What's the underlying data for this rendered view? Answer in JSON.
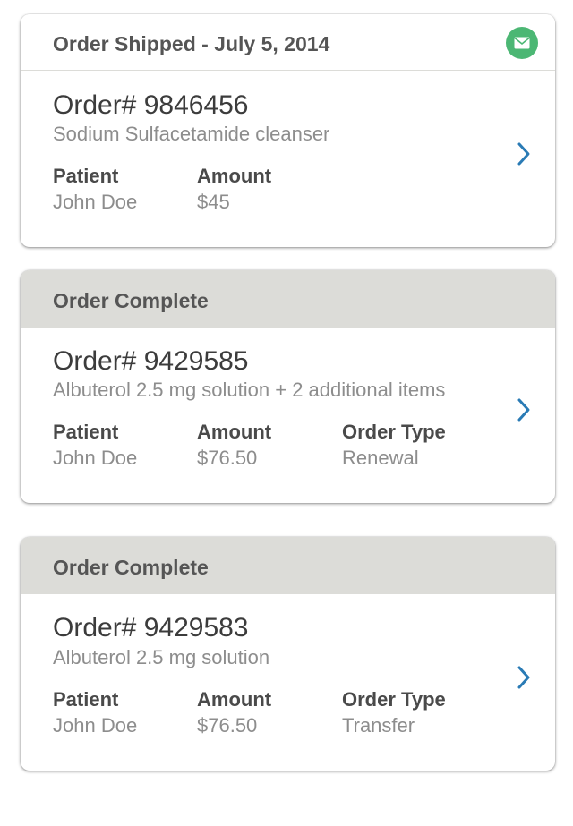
{
  "cards": [
    {
      "header": "Order Shipped - July 5, 2014",
      "status_icon": "envelope-icon",
      "order_number": "Order# 9846456",
      "description": "Sodium Sulfacetamide cleanser",
      "patient_label": "Patient",
      "patient_value": "John Doe",
      "amount_label": "Amount",
      "amount_value": "$45"
    },
    {
      "header": "Order Complete",
      "order_number": "Order# 9429585",
      "description": "Albuterol 2.5 mg solution + 2 additional items",
      "patient_label": "Patient",
      "patient_value": "John Doe",
      "amount_label": "Amount",
      "amount_value": "$76.50",
      "type_label": "Order Type",
      "type_value": "Renewal"
    },
    {
      "header": "Order Complete",
      "order_number": "Order# 9429583",
      "description": "Albuterol 2.5 mg solution",
      "patient_label": "Patient",
      "patient_value": "John Doe",
      "amount_label": "Amount",
      "amount_value": "$76.50",
      "type_label": "Order Type",
      "type_value": "Transfer"
    }
  ],
  "colors": {
    "complete_header_bg": "#dcdcd8",
    "mail_badge": "#4cb774",
    "chevron": "#2a7bb5"
  }
}
